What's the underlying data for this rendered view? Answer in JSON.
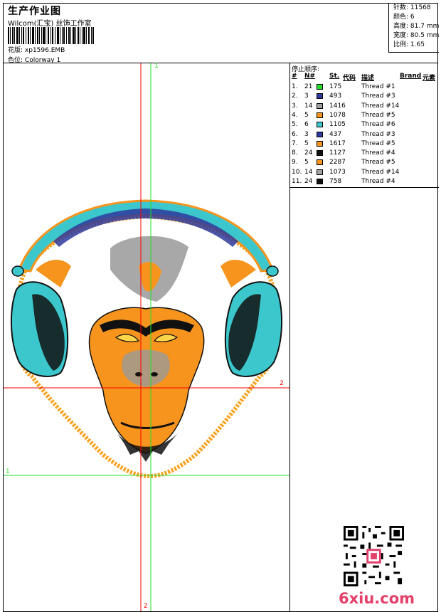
{
  "header": {
    "title": "生产作业图",
    "company": "Wilcom(汇宝) 丝饰工作室",
    "design_label": "花版:",
    "design_value": "xp1596.EMB",
    "colorway_label": "色位:",
    "colorway_value": "Colorway 1"
  },
  "stats": [
    {
      "label": "针数:",
      "value": "11568"
    },
    {
      "label": "颜色:",
      "value": "6"
    },
    {
      "label": "高度:",
      "value": "81.7 mm"
    },
    {
      "label": "宽度:",
      "value": "80.5 mm"
    },
    {
      "label": "比例:",
      "value": "1.65"
    }
  ],
  "panel": {
    "stop_title": "停止顺序:",
    "columns": [
      "#",
      "N#",
      "St.",
      "代码",
      "描述",
      "Brand",
      "元素"
    ],
    "rows": [
      {
        "idx": "1.",
        "n": "21",
        "color": "#22e02a",
        "st": "175",
        "desc": "Thread #1"
      },
      {
        "idx": "2.",
        "n": "3",
        "color": "#2e3a9c",
        "st": "493",
        "desc": "Thread #3"
      },
      {
        "idx": "3.",
        "n": "14",
        "color": "#a0a0a0",
        "st": "1416",
        "desc": "Thread #14"
      },
      {
        "idx": "4.",
        "n": "5",
        "color": "#f7941d",
        "st": "1078",
        "desc": "Thread #5"
      },
      {
        "idx": "5.",
        "n": "6",
        "color": "#3cc7cc",
        "st": "1105",
        "desc": "Thread #6"
      },
      {
        "idx": "6.",
        "n": "3",
        "color": "#2e3a9c",
        "st": "437",
        "desc": "Thread #3"
      },
      {
        "idx": "7.",
        "n": "5",
        "color": "#f7941d",
        "st": "1617",
        "desc": "Thread #5"
      },
      {
        "idx": "8.",
        "n": "24",
        "color": "#111111",
        "st": "1127",
        "desc": "Thread #4"
      },
      {
        "idx": "9.",
        "n": "5",
        "color": "#f7941d",
        "st": "2287",
        "desc": "Thread #5"
      },
      {
        "idx": "10.",
        "n": "14",
        "color": "#a0a0a0",
        "st": "1073",
        "desc": "Thread #14"
      },
      {
        "idx": "11.",
        "n": "24",
        "color": "#111111",
        "st": "758",
        "desc": "Thread #4"
      }
    ],
    "watermark": "6xiu.com"
  },
  "guides": {
    "v1_top": "1",
    "v2_bottom": "2",
    "h2_right": "2",
    "h1_left": "1"
  }
}
